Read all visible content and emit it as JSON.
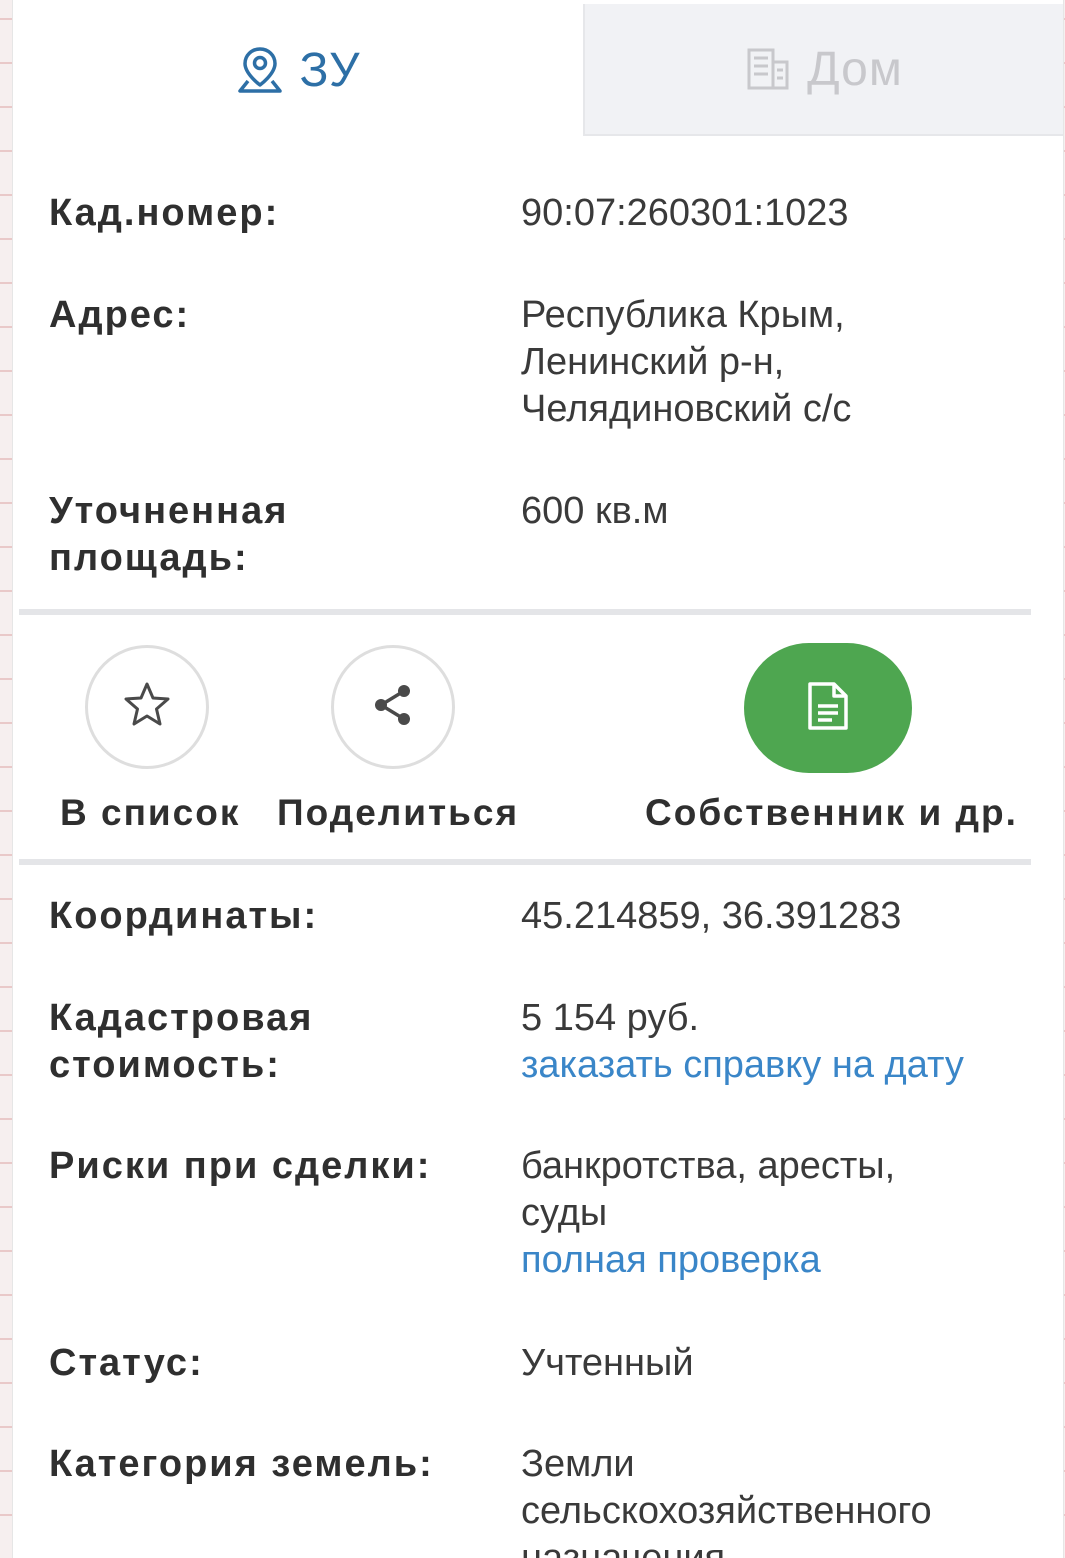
{
  "tabs": [
    {
      "label": "ЗУ",
      "icon": "map-pin-icon",
      "active": true
    },
    {
      "label": "Дом",
      "icon": "building-icon",
      "active": false
    }
  ],
  "details": {
    "cad_number": {
      "label": "Кад.номер:",
      "value": "90:07:260301:1023"
    },
    "address": {
      "label": "Адрес:",
      "lines": [
        "Республика Крым,",
        "Ленинский р-н,",
        "Челядиновский с/с"
      ]
    },
    "area": {
      "label_lines": [
        "Уточненная",
        "площадь:"
      ],
      "value": "600 кв.м"
    }
  },
  "actions": {
    "favorite": {
      "label": "В список",
      "icon": "star-icon"
    },
    "share": {
      "label": "Поделиться",
      "icon": "share-icon"
    },
    "owner": {
      "label": "Собственник и др.",
      "icon": "document-icon",
      "color": "#4ea650"
    }
  },
  "more": {
    "coords": {
      "label": "Координаты:",
      "value": "45.214859, 36.391283"
    },
    "cadastral_cost": {
      "label_lines": [
        "Кадастровая",
        "стоимость:"
      ],
      "value": "5 154 руб.",
      "link": "заказать справку на дату"
    },
    "risks": {
      "label": "Риски при сделки:",
      "lines": [
        "банкротства, аресты,",
        "суды"
      ],
      "link": "полная проверка"
    },
    "status": {
      "label": "Статус:",
      "value": "Учтенный"
    },
    "land_category": {
      "label": "Категория земель:",
      "lines": [
        "Земли",
        "сельскохозяйственного",
        "назначения"
      ]
    }
  },
  "colors": {
    "accent": "#2d6fa6",
    "link": "#3a86c8",
    "primary_button": "#4ea650"
  }
}
